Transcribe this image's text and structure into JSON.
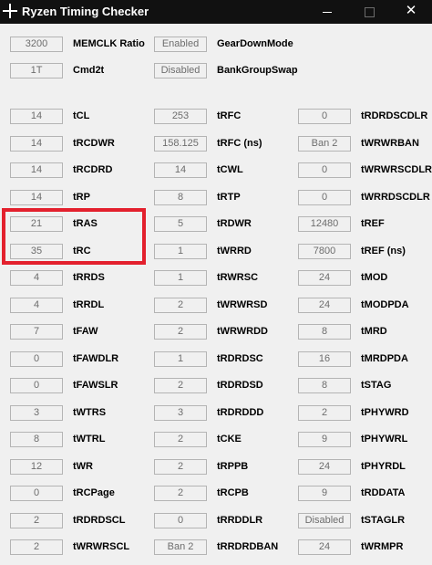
{
  "window": {
    "title": "Ryzen Timing Checker",
    "close_glyph": "✕"
  },
  "highlight_color": "#e3202d",
  "top_rows": [
    {
      "v1": "3200",
      "l1": "MEMCLK Ratio",
      "v2": "Enabled",
      "l2": "GearDownMode"
    },
    {
      "v1": "1T",
      "l1": "Cmd2t",
      "v2": "Disabled",
      "l2": "BankGroupSwap"
    }
  ],
  "rows": [
    {
      "v1": "14",
      "l1": "tCL",
      "v2": "253",
      "l2": "tRFC",
      "v3": "0",
      "l3": "tRDRDSCDLR"
    },
    {
      "v1": "14",
      "l1": "tRCDWR",
      "v2": "158.125",
      "l2": "tRFC (ns)",
      "v3": "Ban 2",
      "l3": "tWRWRBAN"
    },
    {
      "v1": "14",
      "l1": "tRCDRD",
      "v2": "14",
      "l2": "tCWL",
      "v3": "0",
      "l3": "tWRWRSCDLR"
    },
    {
      "v1": "14",
      "l1": "tRP",
      "v2": "8",
      "l2": "tRTP",
      "v3": "0",
      "l3": "tWRRDSCDLR"
    },
    {
      "v1": "21",
      "l1": "tRAS",
      "v2": "5",
      "l2": "tRDWR",
      "v3": "12480",
      "l3": "tREF"
    },
    {
      "v1": "35",
      "l1": "tRC",
      "v2": "1",
      "l2": "tWRRD",
      "v3": "7800",
      "l3": "tREF (ns)"
    },
    {
      "v1": "4",
      "l1": "tRRDS",
      "v2": "1",
      "l2": "tRWRSC",
      "v3": "24",
      "l3": "tMOD"
    },
    {
      "v1": "4",
      "l1": "tRRDL",
      "v2": "2",
      "l2": "tWRWRSD",
      "v3": "24",
      "l3": "tMODPDA"
    },
    {
      "v1": "7",
      "l1": "tFAW",
      "v2": "2",
      "l2": "tWRWRDD",
      "v3": "8",
      "l3": "tMRD"
    },
    {
      "v1": "0",
      "l1": "tFAWDLR",
      "v2": "1",
      "l2": "tRDRDSC",
      "v3": "16",
      "l3": "tMRDPDA"
    },
    {
      "v1": "0",
      "l1": "tFAWSLR",
      "v2": "2",
      "l2": "tRDRDSD",
      "v3": "8",
      "l3": "tSTAG"
    },
    {
      "v1": "3",
      "l1": "tWTRS",
      "v2": "3",
      "l2": "tRDRDDD",
      "v3": "2",
      "l3": "tPHYWRD"
    },
    {
      "v1": "8",
      "l1": "tWTRL",
      "v2": "2",
      "l2": "tCKE",
      "v3": "9",
      "l3": "tPHYWRL"
    },
    {
      "v1": "12",
      "l1": "tWR",
      "v2": "2",
      "l2": "tRPPB",
      "v3": "24",
      "l3": "tPHYRDL"
    },
    {
      "v1": "0",
      "l1": "tRCPage",
      "v2": "2",
      "l2": "tRCPB",
      "v3": "9",
      "l3": "tRDDATA"
    },
    {
      "v1": "2",
      "l1": "tRDRDSCL",
      "v2": "0",
      "l2": "tRRDDLR",
      "v3": "Disabled",
      "l3": "tSTAGLR"
    },
    {
      "v1": "2",
      "l1": "tWRWRSCL",
      "v2": "Ban 2",
      "l2": "tRRDRDBAN",
      "v3": "24",
      "l3": "tWRMPR"
    }
  ]
}
